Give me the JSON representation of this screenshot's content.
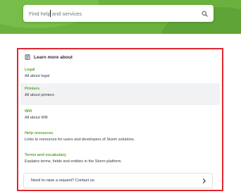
{
  "search": {
    "placeholder": "Find help and services"
  },
  "learn_more": {
    "title": "Learn more about",
    "topics": [
      {
        "name": "Legal",
        "description": "All about legal"
      },
      {
        "name": "Printers",
        "description": "All about printers"
      },
      {
        "name": "Wifi",
        "description": "All about Wifi"
      },
      {
        "name": "Help resources",
        "description": "Links to resources for users and developers of Storm solutions."
      },
      {
        "name": "Terms and vocabulary",
        "description": "Explains terms, fields and entities in the Storm platform."
      }
    ],
    "contact_label": "Need to raise a request? Contact us."
  },
  "colors": {
    "brand_green": "#6ab23d",
    "link_green": "#5aa52c",
    "highlight_border": "#e3262b"
  },
  "icons": {
    "search": "search-icon",
    "book": "book-icon",
    "chevron": "chevron-right-icon"
  }
}
